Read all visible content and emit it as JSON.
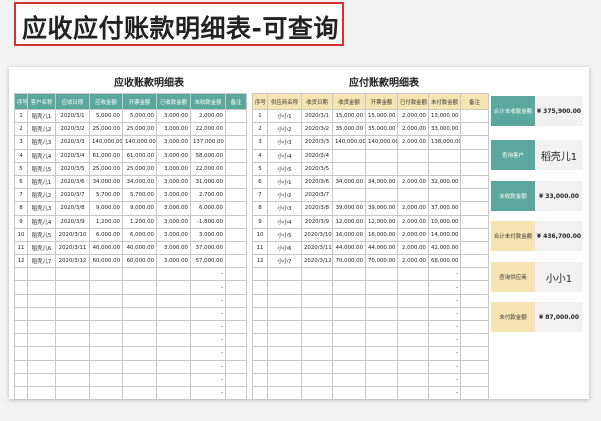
{
  "page_title": "应收应付账款明细表-可查询",
  "receivable": {
    "title": "应收账款明细表",
    "headers": [
      "序号",
      "客户名称",
      "应收日期",
      "应收金额",
      "开票金额",
      "已收款金额",
      "未收款金额",
      "备注"
    ],
    "rows": [
      [
        "1",
        "稻壳儿1",
        "2020/3/1",
        "5,000.00",
        "5,000.00",
        "3,000.00",
        "2,000.00",
        ""
      ],
      [
        "2",
        "稻壳儿2",
        "2020/3/2",
        "25,000.00",
        "25,000.00",
        "3,000.00",
        "22,000.00",
        ""
      ],
      [
        "3",
        "稻壳儿3",
        "2020/3/3",
        "140,000.00",
        "140,000.00",
        "3,000.00",
        "137,000.00",
        ""
      ],
      [
        "4",
        "稻壳儿4",
        "2020/3/4",
        "61,000.00",
        "61,000.00",
        "3,000.00",
        "58,000.00",
        ""
      ],
      [
        "5",
        "稻壳儿5",
        "2020/3/5",
        "25,000.00",
        "25,000.00",
        "3,000.00",
        "22,000.00",
        ""
      ],
      [
        "6",
        "稻壳儿1",
        "2020/3/6",
        "34,000.00",
        "34,000.00",
        "3,000.00",
        "31,000.00",
        ""
      ],
      [
        "7",
        "稻壳儿2",
        "2020/3/7",
        "5,700.00",
        "5,700.00",
        "3,000.00",
        "2,700.00",
        ""
      ],
      [
        "8",
        "稻壳儿3",
        "2020/3/8",
        "9,000.00",
        "9,000.00",
        "3,000.00",
        "6,000.00",
        ""
      ],
      [
        "9",
        "稻壳儿4",
        "2020/3/9",
        "1,200.00",
        "1,200.00",
        "3,000.00",
        "-1,800.00",
        ""
      ],
      [
        "10",
        "稻壳儿5",
        "2020/3/10",
        "6,000.00",
        "6,000.00",
        "3,000.00",
        "3,000.00",
        ""
      ],
      [
        "11",
        "稻壳儿6",
        "2020/3/11",
        "40,000.00",
        "40,000.00",
        "3,000.00",
        "37,000.00",
        ""
      ],
      [
        "12",
        "稻壳儿7",
        "2020/3/12",
        "60,000.00",
        "60,000.00",
        "3,000.00",
        "57,000.00",
        ""
      ]
    ],
    "blank_mark": "-"
  },
  "payable": {
    "title": "应付账款明细表",
    "headers": [
      "序号",
      "供应商名称",
      "收货日期",
      "收货金额",
      "开票金额",
      "已付款金额",
      "未付款金额",
      "备注"
    ],
    "rows": [
      [
        "1",
        "小小1",
        "2020/3/1",
        "15,000.00",
        "15,000.00",
        "2,000.00",
        "13,000.00",
        ""
      ],
      [
        "2",
        "小小2",
        "2020/3/2",
        "35,000.00",
        "35,000.00",
        "2,000.00",
        "33,000.00",
        ""
      ],
      [
        "3",
        "小小3",
        "2020/3/3",
        "140,000.00",
        "140,000.00",
        "2,000.00",
        "138,000.00",
        ""
      ],
      [
        "4",
        "小小4",
        "2020/3/4",
        "",
        "",
        "",
        "",
        ""
      ],
      [
        "5",
        "小小5",
        "2020/3/5",
        "",
        "",
        "",
        "",
        ""
      ],
      [
        "6",
        "小小1",
        "2020/3/6",
        "34,000.00",
        "34,000.00",
        "2,000.00",
        "32,000.00",
        ""
      ],
      [
        "7",
        "小小2",
        "2020/3/7",
        "",
        "",
        "",
        "",
        ""
      ],
      [
        "8",
        "小小3",
        "2020/3/8",
        "39,000.00",
        "39,000.00",
        "2,000.00",
        "37,000.00",
        ""
      ],
      [
        "9",
        "小小4",
        "2020/3/9",
        "12,000.00",
        "12,000.00",
        "2,000.00",
        "10,000.00",
        ""
      ],
      [
        "10",
        "小小5",
        "2020/3/10",
        "16,000.00",
        "16,000.00",
        "2,000.00",
        "14,000.00",
        ""
      ],
      [
        "11",
        "小小6",
        "2020/3/11",
        "44,000.00",
        "44,000.00",
        "2,000.00",
        "42,000.00",
        ""
      ],
      [
        "12",
        "小小7",
        "2020/3/12",
        "70,000.00",
        "70,000.00",
        "2,000.00",
        "68,000.00",
        ""
      ]
    ],
    "blank_mark": "-"
  },
  "summary": {
    "total_receivable_label": "合计未收款金额",
    "total_receivable_value": "¥ 375,900.00",
    "customer_label": "查询客户",
    "customer_value": "稻壳儿1",
    "customer_unreceived_label": "未收款金额",
    "customer_unreceived_value": "¥ 33,000.00",
    "total_payable_label": "合计未付款金额",
    "total_payable_value": "¥ 436,700.00",
    "supplier_label": "查询供应商",
    "supplier_value": "小小1",
    "supplier_unpaid_label": "未付款金额",
    "supplier_unpaid_value": "¥ 87,000.00"
  }
}
